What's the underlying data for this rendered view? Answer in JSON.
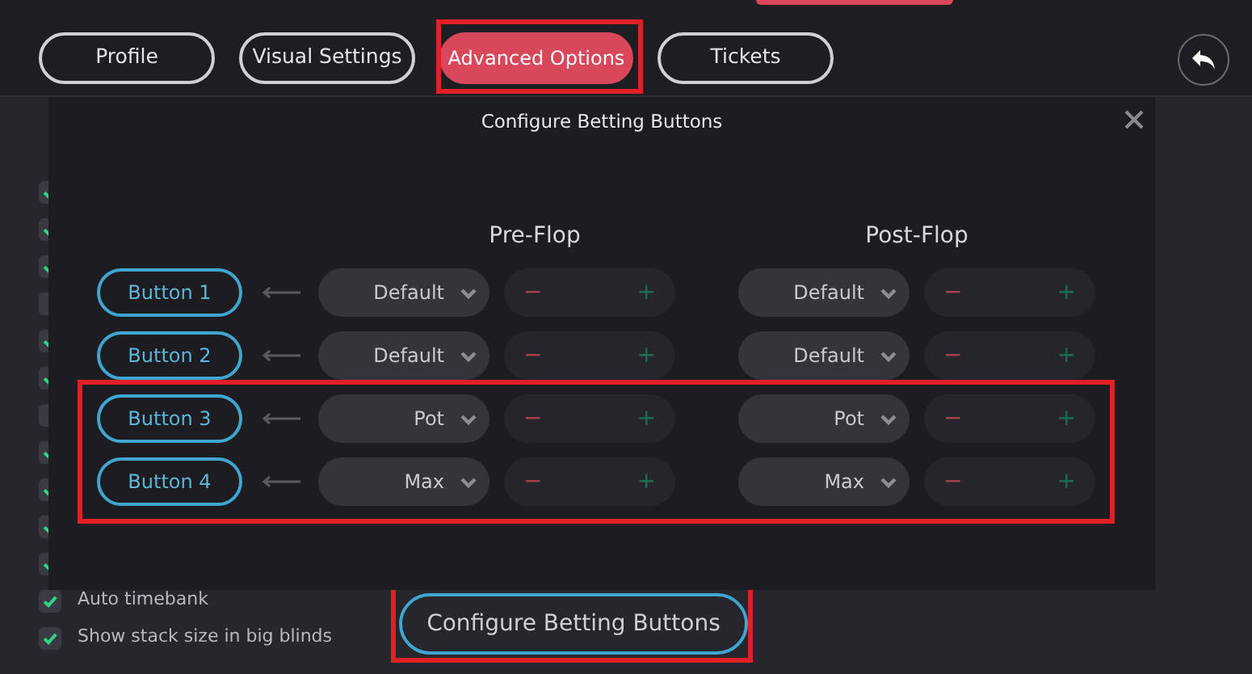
{
  "tabs": [
    {
      "label": "Profile",
      "selected": false
    },
    {
      "label": "Visual Settings",
      "selected": false
    },
    {
      "label": "Advanced Options",
      "selected": true
    },
    {
      "label": "Tickets",
      "selected": false
    }
  ],
  "settings": [
    {
      "checked": true
    },
    {
      "checked": true
    },
    {
      "checked": true
    },
    {
      "checked": false
    },
    {
      "checked": true
    },
    {
      "checked": true
    },
    {
      "checked": false
    },
    {
      "checked": true
    },
    {
      "checked": true
    },
    {
      "checked": true
    },
    {
      "checked": true
    },
    {
      "checked": true,
      "label": "Auto timebank"
    },
    {
      "checked": true,
      "label": "Show stack size in big blinds"
    }
  ],
  "dialog": {
    "title": "Configure Betting Buttons",
    "columns": [
      "Pre-Flop",
      "Post-Flop"
    ],
    "rows": [
      {
        "button": "Button 1",
        "pre": {
          "value": "Default",
          "minus": "−",
          "plus": "+"
        },
        "post": {
          "value": "Default",
          "minus": "−",
          "plus": "+"
        }
      },
      {
        "button": "Button 2",
        "pre": {
          "value": "Default",
          "minus": "−",
          "plus": "+"
        },
        "post": {
          "value": "Default",
          "minus": "−",
          "plus": "+"
        }
      },
      {
        "button": "Button 3",
        "pre": {
          "value": "Pot",
          "minus": "−",
          "plus": "+"
        },
        "post": {
          "value": "Pot",
          "minus": "−",
          "plus": "+"
        }
      },
      {
        "button": "Button 4",
        "pre": {
          "value": "Max",
          "minus": "−",
          "plus": "+"
        },
        "post": {
          "value": "Max",
          "minus": "−",
          "plus": "+"
        }
      }
    ]
  },
  "configure_button": "Configure Betting Buttons"
}
